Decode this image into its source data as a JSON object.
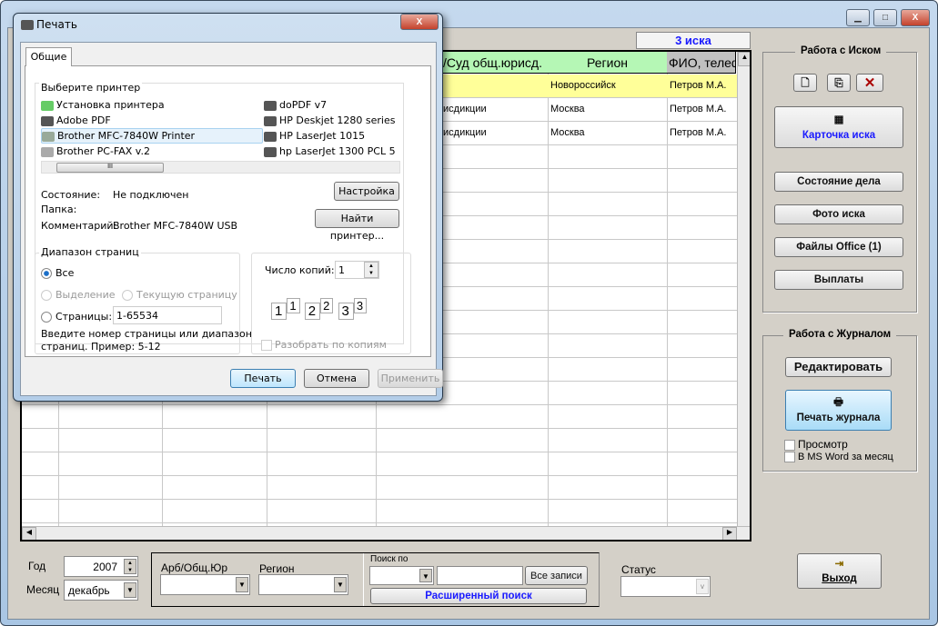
{
  "main_window": {
    "controls": {
      "minimize": "▁",
      "maximize": "□",
      "close": "X"
    }
  },
  "grid": {
    "count_label": "3 иска",
    "headers": [
      "/Суд общ.юрисд.",
      "Регион",
      "ФИО, телеф"
    ],
    "rows": [
      {
        "court": "",
        "region": "Новороссийск",
        "fio": "Петров М.А.",
        "highlight": true
      },
      {
        "court": "исдикции",
        "region": "Москва",
        "fio": "Петров М.А."
      },
      {
        "court": "исдикции",
        "region": "Москва",
        "fio": "Петров М.А."
      }
    ]
  },
  "right_panel": {
    "claim_group_title": "Работа с Иском",
    "claim_card": "Карточка иска",
    "case_status": "Состояние дела",
    "claim_photo": "Фото иска",
    "office_files": "Файлы Office (1)",
    "payments": "Выплаты",
    "journal_group_title": "Работа с Журналом",
    "edit": "Редактировать",
    "print_journal": "Печать журнала",
    "preview": "Просмотр",
    "ms_word": "В MS Word за месяц",
    "exit": "Выход"
  },
  "filters": {
    "year_label": "Год",
    "year_value": "2007",
    "month_label": "Месяц",
    "month_value": "декабрь",
    "court_label": "Арб/Общ.Юр",
    "region_label": "Регион",
    "search_label": "Поиск по",
    "all_records": "Все записи",
    "advanced_search": "Расширенный поиск",
    "status_label": "Статус"
  },
  "print_dialog": {
    "title": "Печать",
    "tab": "Общие",
    "select_printer": "Выберите принтер",
    "printers": [
      "Установка принтера",
      "Adobe PDF",
      "Brother MFC-7840W Printer",
      "Brother PC-FAX v.2",
      "doPDF v7",
      "HP Deskjet 1280 series",
      "HP LaserJet 1015",
      "hp LaserJet 1300 PCL 5"
    ],
    "selected_printer": "Brother MFC-7840W Printer",
    "status_label": "Состояние:",
    "status_value": "Не подключен",
    "folder_label": "Папка:",
    "comment_label": "Комментарий:",
    "comment_value": "Brother MFC-7840W USB",
    "setup": "Настройка",
    "find_printer": "Найти принтер...",
    "range_title": "Диапазон страниц",
    "all": "Все",
    "selection": "Выделение",
    "current_page": "Текущую страницу",
    "pages": "Страницы:",
    "pages_value": "1-65534",
    "hint": "Введите номер страницы или диапазон",
    "hint2": "страниц.  Пример: 5-12",
    "copies_label": "Число копий:",
    "copies_value": "1",
    "collate": "Разобрать по копиям",
    "print": "Печать",
    "cancel": "Отмена",
    "apply": "Применить"
  }
}
